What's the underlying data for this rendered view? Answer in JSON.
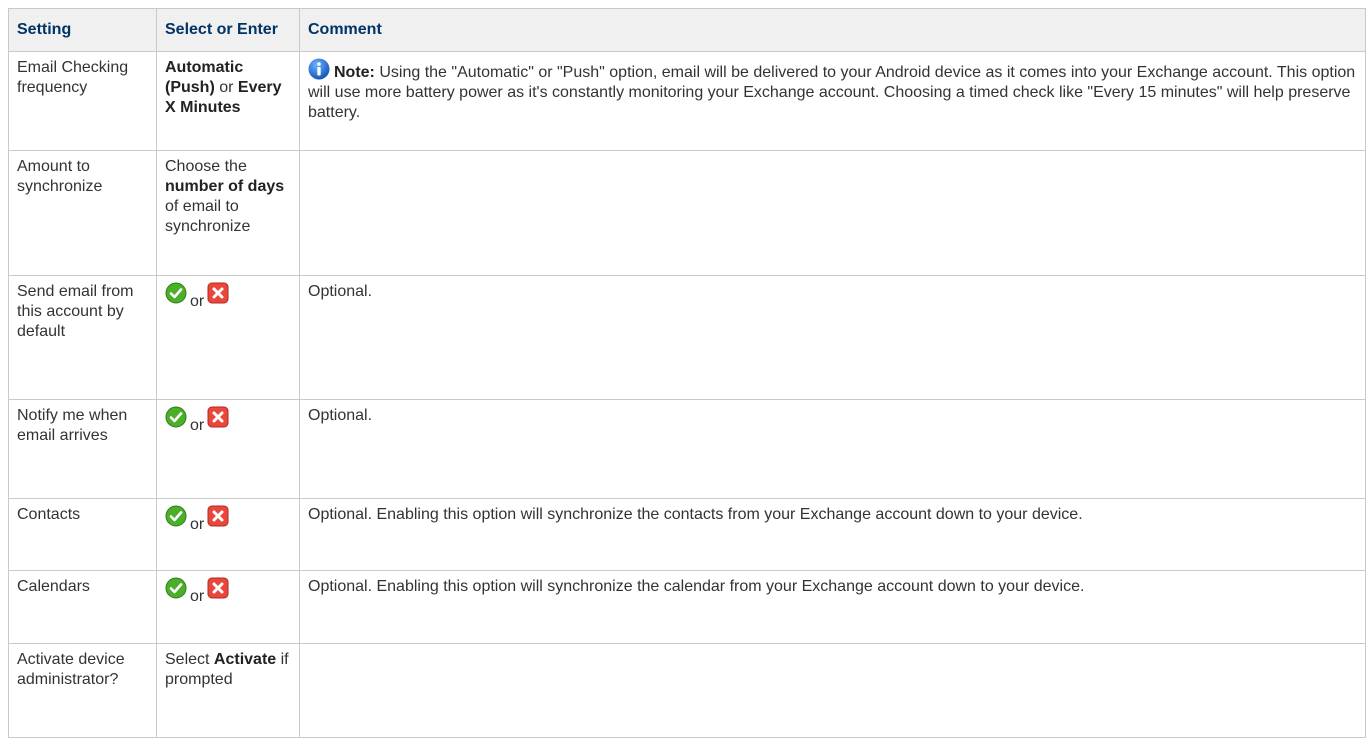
{
  "header": {
    "setting": "Setting",
    "select": "Select or Enter",
    "comment": "Comment"
  },
  "rows": {
    "email": {
      "setting": "Email Checking frequency",
      "opt_a": "Automatic (Push)",
      "or": "or",
      "opt_b": "Every X Minutes",
      "note_label": "Note:",
      "note_text": "Using the \"Automatic\" or \"Push\" option, email will be delivered to your Android device as it comes into your Exchange account. This option will use more battery power as it's constantly monitoring your Exchange account. Choosing a timed check like \"Every 15 minutes\" will help preserve battery."
    },
    "amount": {
      "setting": "Amount to synchronize",
      "pre": "Choose the",
      "bold": "number of days",
      "post": "of email to synchronize"
    },
    "send": {
      "setting": "Send email from this account by default",
      "or": "or",
      "comment": "Optional."
    },
    "notify": {
      "setting": "Notify me when email arrives",
      "or": "or",
      "comment": "Optional."
    },
    "contacts": {
      "setting": "Contacts",
      "or": "or",
      "comment": "Optional. Enabling this option will synchronize the contacts from your Exchange account down to your device."
    },
    "calendars": {
      "setting": "Calendars",
      "or": "or",
      "comment": "Optional. Enabling this option will synchronize the calendar from your Exchange account down to your device."
    },
    "activate": {
      "setting": "Activate device administrator?",
      "pre": "Select",
      "bold": "Activate",
      "post": "if prompted"
    }
  },
  "icons": {
    "check": "check-circle-icon",
    "cross": "cross-box-icon",
    "info": "info-icon"
  },
  "colors": {
    "header_text": "#003366",
    "header_bg": "#f0f0f0",
    "check_green": "#4caf2a",
    "cross_red": "#e8473c",
    "info_blue": "#1f6fd6"
  }
}
